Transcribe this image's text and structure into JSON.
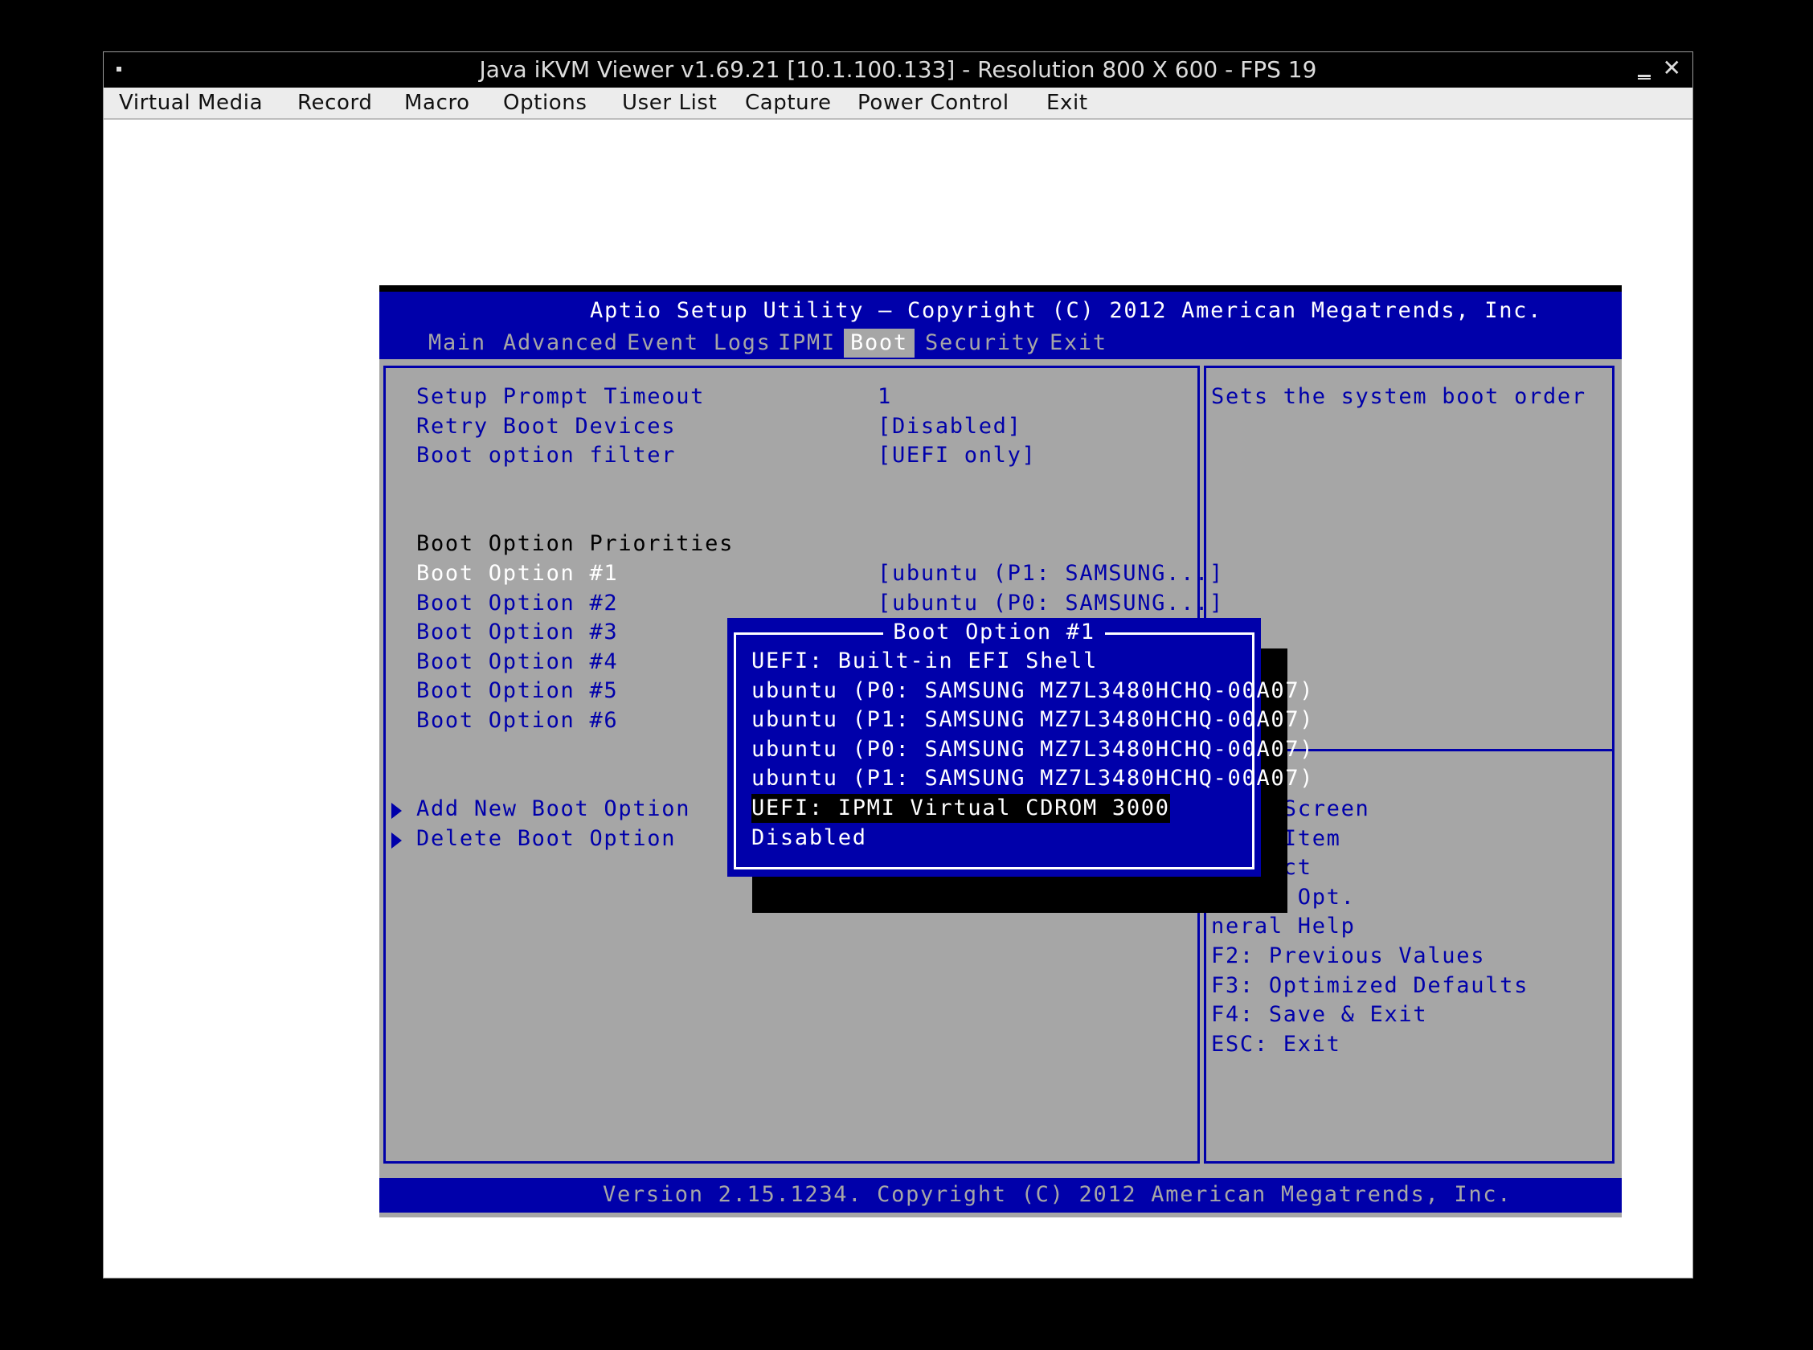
{
  "window": {
    "title": "Java iKVM Viewer v1.69.21 [10.1.100.133]  - Resolution 800 X 600 - FPS 19",
    "close_glyph": "✕"
  },
  "menubar": [
    "Virtual Media",
    "Record",
    "Macro",
    "Options",
    "User List",
    "Capture",
    "Power Control",
    "Exit"
  ],
  "bios": {
    "header_title": "Aptio Setup Utility – Copyright (C) 2012 American Megatrends, Inc.",
    "tabs": [
      "Main",
      "Advanced",
      "Event Logs",
      "IPMI",
      "Boot",
      "Security",
      "Exit"
    ],
    "active_tab": "Boot",
    "settings": [
      {
        "label": "Setup Prompt Timeout",
        "value": "1"
      },
      {
        "label": "Retry Boot Devices",
        "value": "[Disabled]"
      },
      {
        "label": "Boot option filter",
        "value": "[UEFI only]"
      }
    ],
    "priorities_heading": "Boot Option Priorities",
    "boot_options": [
      {
        "label": "Boot Option #1",
        "value": "[ubuntu (P1: SAMSUNG...]"
      },
      {
        "label": "Boot Option #2",
        "value": "[ubuntu (P0: SAMSUNG...]"
      },
      {
        "label": "Boot Option #3",
        "value": ""
      },
      {
        "label": "Boot Option #4",
        "value": ""
      },
      {
        "label": "Boot Option #5",
        "value": ""
      },
      {
        "label": "Boot Option #6",
        "value": ""
      }
    ],
    "submenus": [
      "Add New Boot Option",
      "Delete Boot Option"
    ],
    "help_text": "Sets the system boot order",
    "key_help": [
      "lect Screen",
      "lect Item",
      " Select",
      "hange Opt.",
      "neral Help",
      "F2: Previous Values",
      "F3: Optimized Defaults",
      "F4: Save & Exit",
      "ESC: Exit"
    ],
    "footer": "Version 2.15.1234. Copyright (C) 2012 American Megatrends, Inc.",
    "popup": {
      "title": "Boot Option #1",
      "items": [
        "UEFI: Built-in EFI Shell",
        "ubuntu (P0: SAMSUNG MZ7L3480HCHQ-00A07)",
        "ubuntu (P1: SAMSUNG MZ7L3480HCHQ-00A07)",
        "ubuntu (P0: SAMSUNG MZ7L3480HCHQ-00A07)",
        "ubuntu (P1: SAMSUNG MZ7L3480HCHQ-00A07)",
        "UEFI: IPMI Virtual CDROM 3000",
        "Disabled"
      ],
      "selected_index": 5
    }
  },
  "colors": {
    "bios_blue": "#0000aa",
    "bios_gray": "#a6a6a6",
    "bios_white": "#ffffff"
  }
}
